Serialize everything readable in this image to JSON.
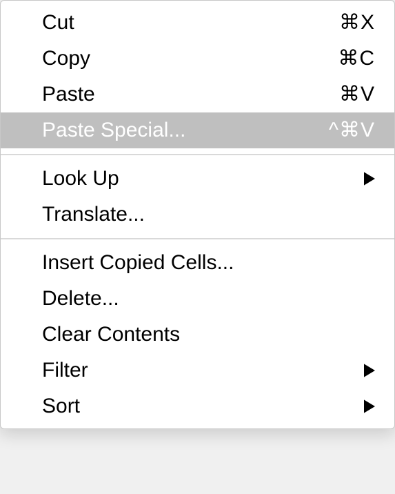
{
  "menu": {
    "groups": [
      {
        "items": [
          {
            "id": "cut",
            "label": "Cut",
            "shortcut": "⌘X",
            "submenu": false,
            "highlighted": false
          },
          {
            "id": "copy",
            "label": "Copy",
            "shortcut": "⌘C",
            "submenu": false,
            "highlighted": false
          },
          {
            "id": "paste",
            "label": "Paste",
            "shortcut": "⌘V",
            "submenu": false,
            "highlighted": false
          },
          {
            "id": "paste-special",
            "label": "Paste Special...",
            "shortcut": "^⌘V",
            "submenu": false,
            "highlighted": true
          }
        ]
      },
      {
        "items": [
          {
            "id": "look-up",
            "label": "Look Up",
            "shortcut": "",
            "submenu": true,
            "highlighted": false
          },
          {
            "id": "translate",
            "label": "Translate...",
            "shortcut": "",
            "submenu": false,
            "highlighted": false
          }
        ]
      },
      {
        "items": [
          {
            "id": "insert-copied-cells",
            "label": "Insert Copied Cells...",
            "shortcut": "",
            "submenu": false,
            "highlighted": false
          },
          {
            "id": "delete",
            "label": "Delete...",
            "shortcut": "",
            "submenu": false,
            "highlighted": false
          },
          {
            "id": "clear-contents",
            "label": "Clear Contents",
            "shortcut": "",
            "submenu": false,
            "highlighted": false
          },
          {
            "id": "filter",
            "label": "Filter",
            "shortcut": "",
            "submenu": true,
            "highlighted": false
          },
          {
            "id": "sort",
            "label": "Sort",
            "shortcut": "",
            "submenu": true,
            "highlighted": false
          }
        ]
      }
    ]
  }
}
